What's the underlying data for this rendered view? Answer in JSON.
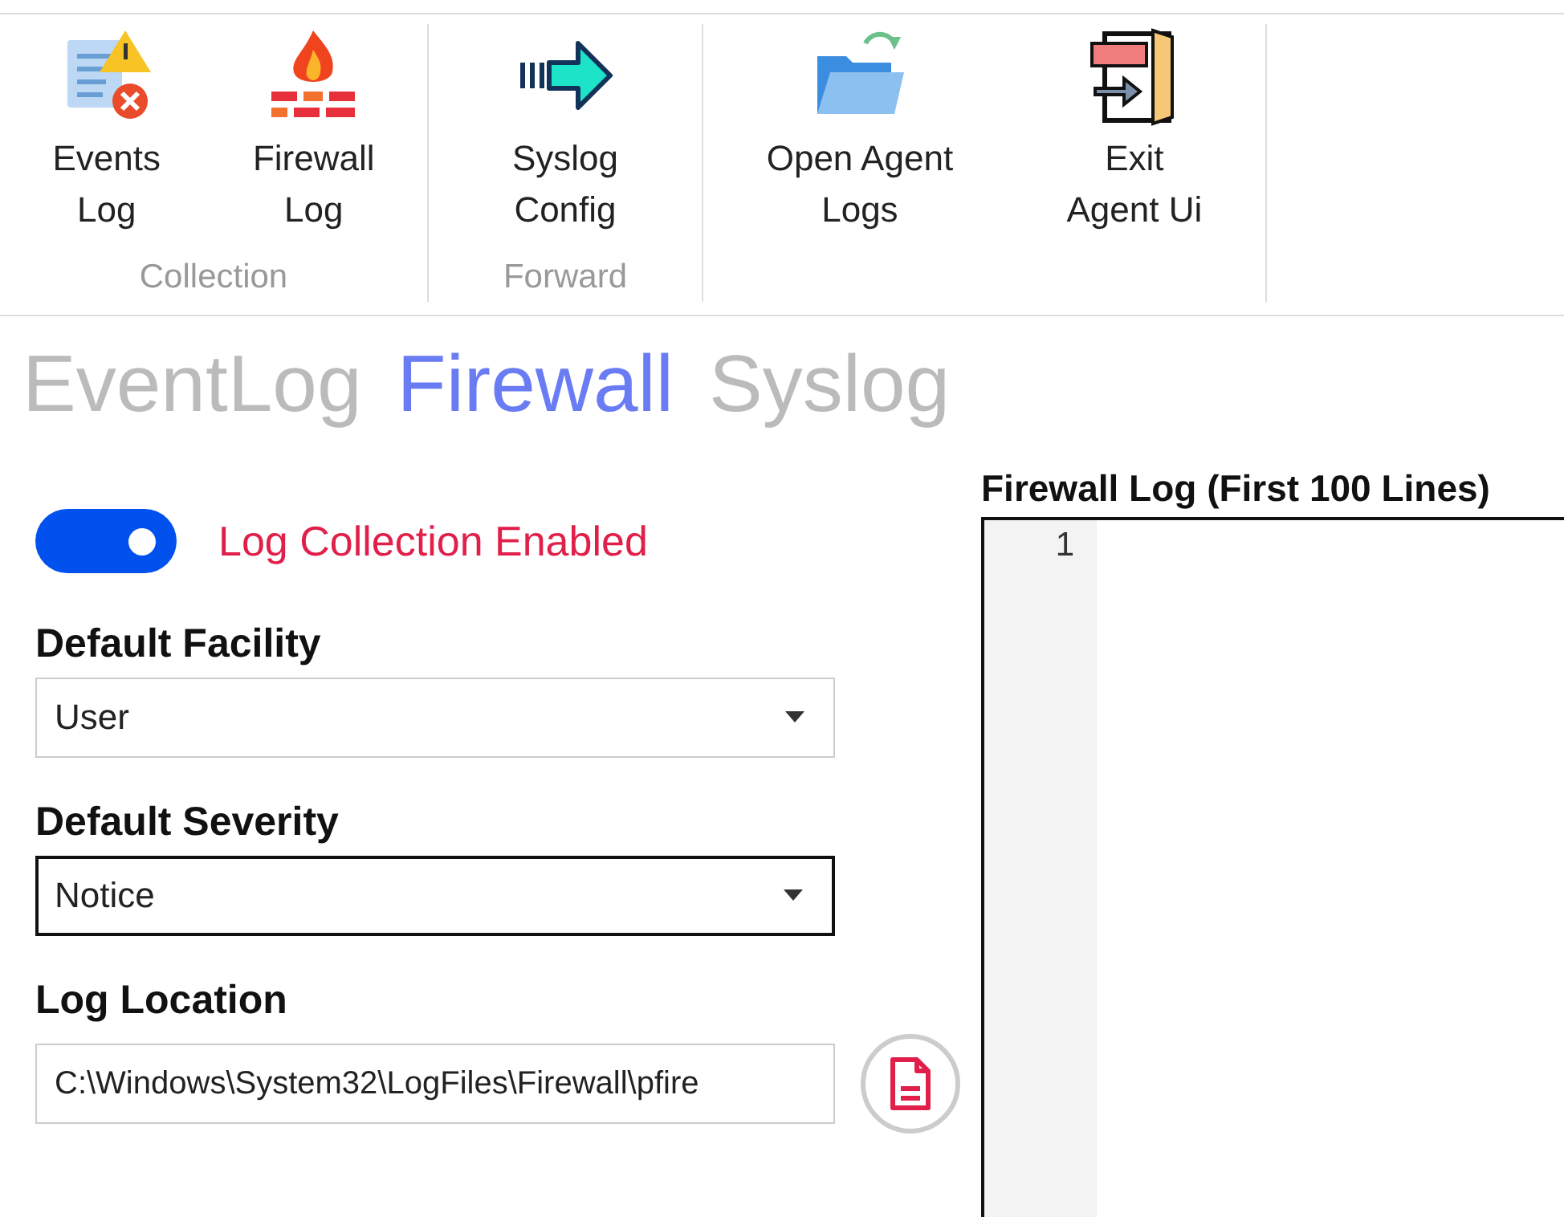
{
  "ribbon": {
    "groups": [
      {
        "label": "Collection",
        "buttons": [
          {
            "label": "Events\nLog"
          },
          {
            "label": "Firewall\nLog"
          }
        ]
      },
      {
        "label": "Forward",
        "buttons": [
          {
            "label": "Syslog\nConfig"
          }
        ]
      },
      {
        "buttons": [
          {
            "label": "Open Agent\nLogs"
          },
          {
            "label": "Exit\nAgent Ui"
          }
        ]
      }
    ]
  },
  "tabs": [
    {
      "label": "EventLog",
      "selected": false
    },
    {
      "label": "Firewall",
      "selected": true
    },
    {
      "label": "Syslog",
      "selected": false
    }
  ],
  "toggle": {
    "label": "Log Collection Enabled",
    "on": true
  },
  "fields": [
    {
      "kind": "select",
      "label": "Default Facility",
      "value": "User",
      "focused": false
    },
    {
      "kind": "select",
      "label": "Default Severity",
      "value": "Notice",
      "focused": true
    },
    {
      "kind": "path",
      "label": "Log Location",
      "value": "C:\\Windows\\System32\\LogFiles\\Firewall\\pfire",
      "focused": false
    }
  ],
  "log_panel": {
    "title": "Firewall Log (First 100 Lines)",
    "line_numbers": [
      "1"
    ]
  }
}
